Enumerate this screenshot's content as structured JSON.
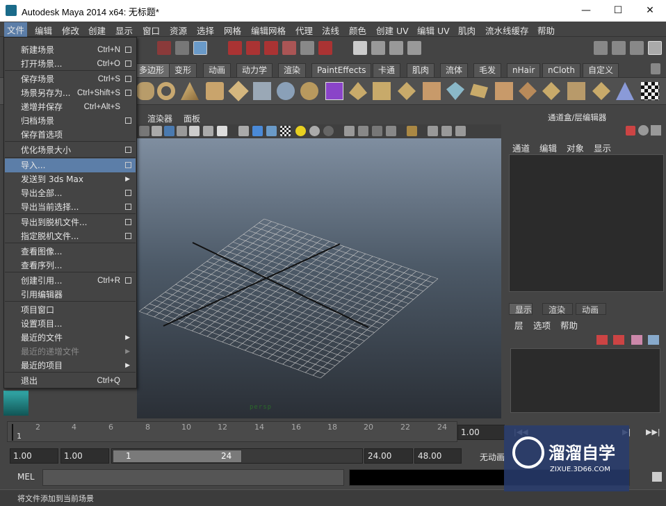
{
  "window": {
    "title": "Autodesk Maya 2014 x64: 无标题*",
    "minimize": "—",
    "maximize": "☐",
    "close": "✕"
  },
  "menubar": [
    "文件",
    "编辑",
    "修改",
    "创建",
    "显示",
    "窗口",
    "资源",
    "选择",
    "网格",
    "编辑网格",
    "代理",
    "法线",
    "颜色",
    "创建 UV",
    "编辑 UV",
    "肌肉",
    "流水线缓存",
    "帮助"
  ],
  "shelf_tabs": [
    "多边形",
    "变形",
    "动画",
    "动力学",
    "渲染",
    "PaintEffects",
    "卡通",
    "肌肉",
    "流体",
    "毛发",
    "nHair",
    "nCloth",
    "自定义"
  ],
  "viewport": {
    "menus": [
      "渲染器",
      "面板"
    ],
    "camera_label": "persp"
  },
  "channel_box": {
    "title": "通道盒/层编辑器",
    "menus": [
      "通道",
      "编辑",
      "对象",
      "显示"
    ]
  },
  "layer_editor": {
    "tabs": [
      "显示",
      "渲染",
      "动画"
    ],
    "menus": [
      "层",
      "选项",
      "帮助"
    ]
  },
  "file_menu": {
    "items": [
      {
        "label": "新建场景",
        "shortcut": "Ctrl+N",
        "option": true
      },
      {
        "label": "打开场景...",
        "shortcut": "Ctrl+O",
        "option": true
      },
      {
        "label": "保存场景",
        "shortcut": "Ctrl+S",
        "option": true
      },
      {
        "label": "场景另存为...",
        "shortcut": "Ctrl+Shift+S",
        "option": true
      },
      {
        "label": "递增并保存",
        "shortcut": "Ctrl+Alt+S",
        "option": false
      },
      {
        "label": "归档场景",
        "shortcut": "",
        "option": true
      },
      {
        "label": "保存首选项",
        "shortcut": "",
        "option": false
      },
      {
        "label": "优化场景大小",
        "shortcut": "",
        "option": true
      },
      {
        "label": "导入...",
        "shortcut": "",
        "option": true
      },
      {
        "label": "发送到 3ds Max",
        "shortcut": "",
        "submenu": true
      },
      {
        "label": "导出全部...",
        "shortcut": "",
        "option": true
      },
      {
        "label": "导出当前选择...",
        "shortcut": "",
        "option": true
      },
      {
        "label": "导出到脱机文件...",
        "shortcut": "",
        "option": true
      },
      {
        "label": "指定脱机文件...",
        "shortcut": "",
        "option": true
      },
      {
        "label": "查看图像...",
        "shortcut": ""
      },
      {
        "label": "查看序列...",
        "shortcut": ""
      },
      {
        "label": "创建引用...",
        "shortcut": "Ctrl+R",
        "option": true
      },
      {
        "label": "引用编辑器",
        "shortcut": ""
      },
      {
        "label": "项目窗口",
        "shortcut": ""
      },
      {
        "label": "设置项目...",
        "shortcut": ""
      },
      {
        "label": "最近的文件",
        "shortcut": "",
        "submenu": true
      },
      {
        "label": "最近的递增文件",
        "shortcut": "",
        "submenu": true,
        "disabled": true
      },
      {
        "label": "最近的项目",
        "shortcut": "",
        "submenu": true
      },
      {
        "label": "退出",
        "shortcut": "Ctrl+Q"
      }
    ]
  },
  "timeline": {
    "ticks": [
      "1",
      "2",
      "4",
      "6",
      "8",
      "10",
      "12",
      "14",
      "16",
      "18",
      "20",
      "22",
      "24"
    ],
    "current_frame": "1.00"
  },
  "range": {
    "start": "1.00",
    "start2": "1.00",
    "slider_start": "1",
    "slider_end": "24",
    "end": "24.00",
    "end2": "48.00",
    "anim_layer": "无动画"
  },
  "command_line": {
    "label": "MEL"
  },
  "status": {
    "help_text": "将文件添加到当前场景"
  },
  "watermark": {
    "title": "溜溜自学",
    "url": "ZIXUE.3D66.COM"
  }
}
